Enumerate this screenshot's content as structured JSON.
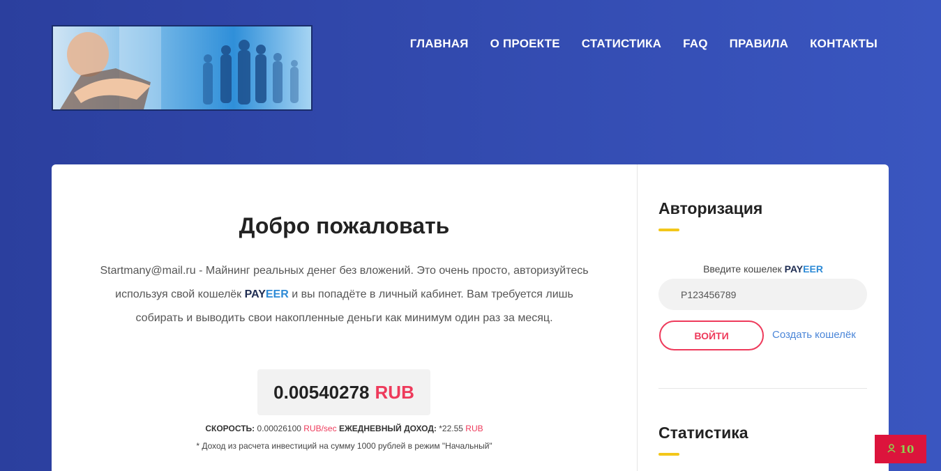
{
  "header": {
    "logo_alt": "logo",
    "nav": [
      {
        "label": "ГЛАВНАЯ"
      },
      {
        "label": "О ПРОЕКТЕ"
      },
      {
        "label": "СТАТИСТИКА"
      },
      {
        "label": "FAQ"
      },
      {
        "label": "ПРАВИЛА"
      },
      {
        "label": "КОНТАКТЫ"
      }
    ]
  },
  "main": {
    "title": "Добро пожаловать",
    "intro_1": "Startmany@mail.ru - Майнинг реальных денег без вложений. Это очень просто, авторизуйтесь используя свой кошелёк ",
    "brand_pay": "PAY",
    "brand_eer": "EER",
    "intro_2": " и вы попадёте в личный кабинет. Вам требуется лишь собирать и выводить свои накопленные деньги как минимум один раз за месяц.",
    "balance_value": "0.00540278",
    "balance_currency": "RUB",
    "speed_label": "СКОРОСТЬ:",
    "speed_value": "0.00026100",
    "speed_unit": "RUB/sec",
    "daily_label": "ЕЖЕДНЕВНЫЙ ДОХОД:",
    "daily_value": "*22.55",
    "daily_unit": "RUB",
    "note": "* Доход из расчета инвестиций на сумму 1000 рублей в режим \"Начальный\""
  },
  "sidebar": {
    "auth_title": "Авторизация",
    "wallet_prompt": "Введите кошелек ",
    "wallet_brand_pay": "PAY",
    "wallet_brand_eer": "EER",
    "wallet_placeholder": "P123456789",
    "login_label": "ВОЙТИ",
    "create_wallet_label": "Создать кошелёк",
    "stats_title": "Статистика"
  },
  "online_badge": {
    "icon": "user-icon",
    "count": "10"
  },
  "colors": {
    "accent_red": "#ee3a5b",
    "accent_yellow": "#f3c71a",
    "bg_blue": "#3149b3",
    "link_blue": "#4b86d8"
  }
}
